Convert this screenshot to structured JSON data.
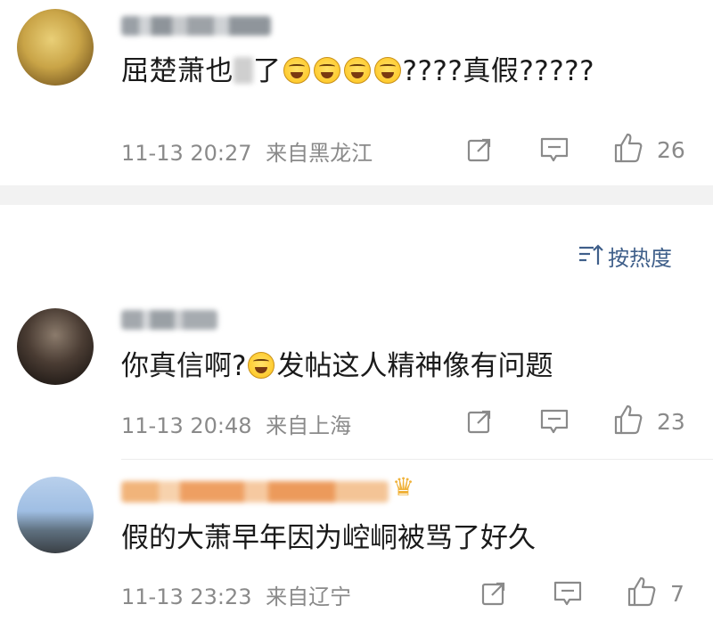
{
  "sort": {
    "label": "按热度"
  },
  "comments": [
    {
      "text_before_smudge": "屈楚萧也",
      "text_after_smudge": "了",
      "emoji_count": 4,
      "text_after_emoji": "????真假?????",
      "timestamp": "11-13 20:27",
      "location": "来自黑龙江",
      "likes": "26",
      "emoji_icon": "laugh-cry-emoji"
    },
    {
      "text_before_emoji": "你真信啊?",
      "text_after_emoji": "发帖这人精神像有问题",
      "timestamp": "11-13 20:48",
      "location": "来自上海",
      "likes": "23",
      "emoji_icon": "laugh-cry-emoji"
    },
    {
      "text": "假的大萧早年因为崆峒被骂了好久",
      "timestamp": "11-13 23:23",
      "location": "来自辽宁",
      "likes": "7",
      "badge_icon": "crown-icon"
    }
  ],
  "icons": {
    "share": "share-icon",
    "reply": "comment-icon",
    "like": "thumbs-up-icon",
    "sort": "sort-icon"
  },
  "colors": {
    "meta_text": "#8a8a8a",
    "sort_text": "#3f5f8a",
    "divider": "#f2f2f2"
  }
}
